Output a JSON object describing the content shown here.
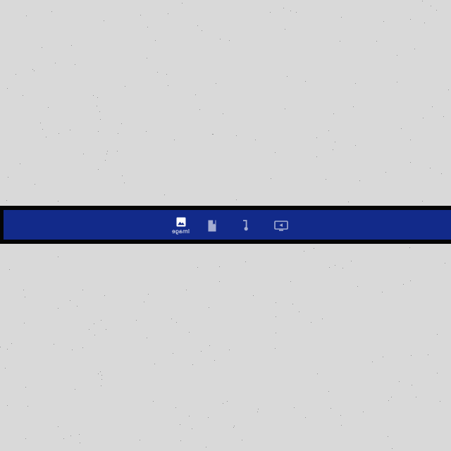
{
  "bottom_nav": {
    "background_color": "#122a8a",
    "frame_color": "#050505",
    "items": [
      {
        "icon": "image-icon",
        "label": "Image",
        "selected": true
      },
      {
        "icon": "bookmark-icon",
        "label": "",
        "selected": false
      },
      {
        "icon": "music-note-icon",
        "label": "",
        "selected": false
      },
      {
        "icon": "tv-play-icon",
        "label": "",
        "selected": false
      }
    ]
  },
  "page": {
    "background_color": "#d9d9d9"
  }
}
